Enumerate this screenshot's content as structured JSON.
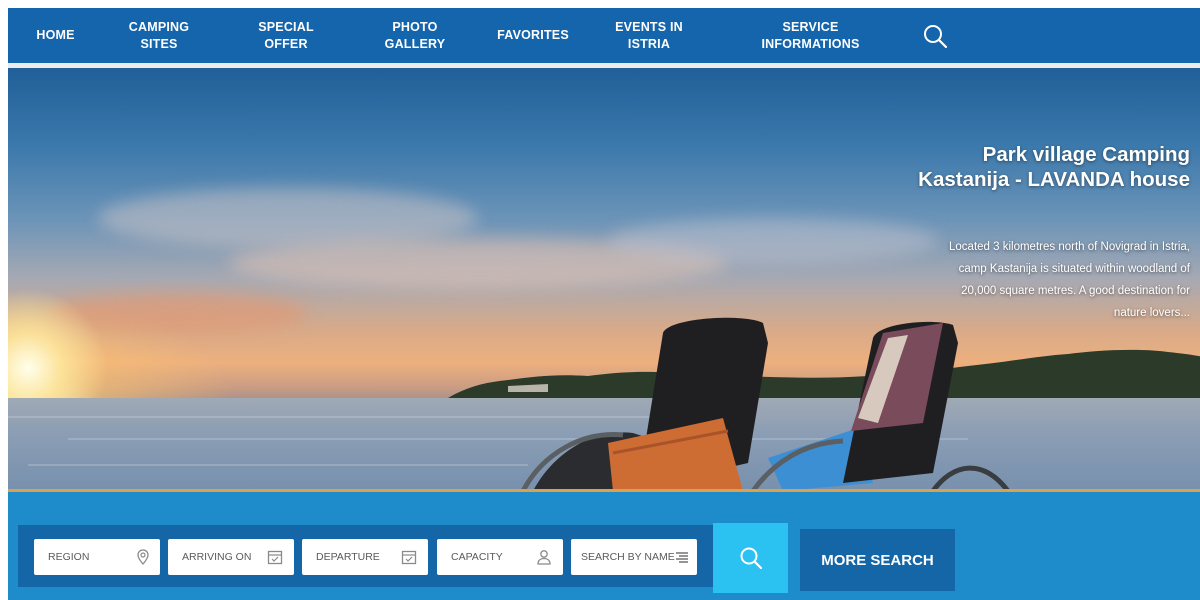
{
  "nav": {
    "items": [
      {
        "label": "HOME"
      },
      {
        "label": "CAMPING\nSITES"
      },
      {
        "label": "SPECIAL\nOFFER"
      },
      {
        "label": "PHOTO\nGALLERY"
      },
      {
        "label": "FAVORITES"
      },
      {
        "label": "EVENTS IN\nISTRIA"
      },
      {
        "label": "SERVICE\nINFORMATIONS"
      }
    ],
    "search_icon": "search-icon"
  },
  "hero": {
    "title": "Park village Camping Kastanija - LAVANDA house",
    "description": "Located 3 kilometres north of Novigrad in Istria, camp Kastanija is situated within woodland of 20,000 square metres. A good destination for nature lovers..."
  },
  "search": {
    "fields": [
      {
        "label": "REGION",
        "icon": "location-pin-icon"
      },
      {
        "label": "ARRIVING ON",
        "icon": "calendar-icon"
      },
      {
        "label": "DEPARTURE",
        "icon": "calendar-icon"
      },
      {
        "label": "CAPACITY",
        "icon": "person-icon"
      },
      {
        "label": "SEARCH BY NAME",
        "icon": "list-icon"
      }
    ],
    "search_button_icon": "search-icon",
    "more_search_label": "MORE SEARCH"
  },
  "colors": {
    "nav_bg": "#1565ad",
    "band_bg": "#1e8ccb",
    "panel_bg": "#1466a7",
    "search_btn": "#2bc1f1",
    "accent_line": "#d9a24c"
  }
}
